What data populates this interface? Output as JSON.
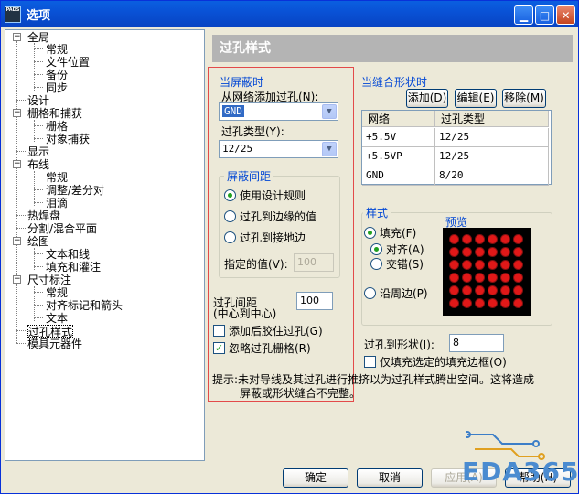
{
  "window": {
    "title": "选项",
    "app_icon_text": "PADS"
  },
  "tree": {
    "items": [
      {
        "label": "全局"
      },
      {
        "label": "常规"
      },
      {
        "label": "文件位置"
      },
      {
        "label": "备份"
      },
      {
        "label": "同步"
      },
      {
        "label": "设计"
      },
      {
        "label": "栅格和捕获"
      },
      {
        "label": "栅格"
      },
      {
        "label": "对象捕获"
      },
      {
        "label": "显示"
      },
      {
        "label": "布线"
      },
      {
        "label": "常规"
      },
      {
        "label": "调整/差分对"
      },
      {
        "label": "泪滴"
      },
      {
        "label": "热焊盘"
      },
      {
        "label": "分割/混合平面"
      },
      {
        "label": "绘图"
      },
      {
        "label": "文本和线"
      },
      {
        "label": "填充和灌注"
      },
      {
        "label": "尺寸标注"
      },
      {
        "label": "常规"
      },
      {
        "label": "对齐标记和箭头"
      },
      {
        "label": "文本"
      },
      {
        "label": "过孔样式"
      },
      {
        "label": "模具元器件"
      }
    ]
  },
  "panel": {
    "header": "过孔样式",
    "shield": {
      "title": "当屏蔽时",
      "add_via_label": "从网络添加过孔(N):",
      "net_value": "GND",
      "via_type_label": "过孔类型(Y):",
      "via_type_value": "12/25",
      "spacing_group": "屏蔽间距",
      "radio_design_rules": "使用设计规则",
      "radio_via_to_edge": "过孔到边缘的值",
      "radio_via_to_ground": "过孔到接地边",
      "specified_label": "指定的值(V):",
      "specified_value": "100",
      "via_spacing_label": "过孔间距",
      "via_spacing_sub": "(中心到中心)",
      "via_spacing_value": "100",
      "check_add_glue": "添加后胶住过孔(G)",
      "check_ignore_grid": "忽略过孔栅格(R)"
    },
    "stitch": {
      "title": "当缝合形状时",
      "btn_add": "添加(D)",
      "btn_edit": "编辑(E)",
      "btn_remove": "移除(M)",
      "col_net": "网络",
      "col_via_type": "过孔类型",
      "rows": [
        {
          "net": "+5.5V",
          "via": "12/25"
        },
        {
          "net": "+5.5VP",
          "via": "12/25"
        },
        {
          "net": "GND",
          "via": "8/20"
        }
      ],
      "style_group": "样式",
      "radio_fill": "填充(F)",
      "radio_align": "对齐(A)",
      "radio_stagger": "交错(S)",
      "radio_along_edge": "沿周边(P)",
      "preview_label": "预览",
      "via_to_shape_label": "过孔到形状(I):",
      "via_to_shape_value": "8",
      "check_only_selected": "仅填充选定的填充边框(O)"
    },
    "hint_line1": "提示:未对导线及其过孔进行推挤以为过孔样式腾出空间。这将造成",
    "hint_line2": "屏蔽或形状缝合不完整。"
  },
  "buttons": {
    "ok": "确定",
    "cancel": "取消",
    "apply": "应用(A)",
    "help": "帮助(H)"
  },
  "watermark": "EDA365",
  "colors": {
    "title_bar": "#0A5FE0",
    "header_bar": "#B4B4B4",
    "red_frame": "#E34A4A",
    "pad": "#E01818"
  }
}
